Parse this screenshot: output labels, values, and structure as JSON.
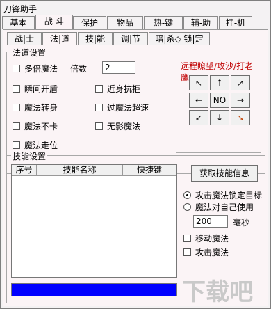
{
  "window": {
    "title": "刀锋助手"
  },
  "main_tabs": [
    "基本",
    "战-斗",
    "保护",
    "物品",
    "热-键",
    "辅-助",
    "挂-机"
  ],
  "sub_tabs": [
    "战|士",
    "法|道",
    "技|能",
    "调|节",
    "暗|杀◇ 锁|定"
  ],
  "fadao_group": {
    "title": "法道设置",
    "multi_magic": "多倍魔法",
    "multiplier_label": "倍数",
    "multiplier_value": "2",
    "instant_shield": "瞬间开盾",
    "close_resist": "近身抗拒",
    "magic_transfer": "魔法转身",
    "magic_overspeed": "过魔法超速",
    "magic_no_lag": "魔法不卡",
    "no_shadow": "无影魔法",
    "magic_walk": "魔法走位"
  },
  "direction_group": {
    "title": "远程瞭望/攻沙/打老鹰",
    "up_left": "↖",
    "up": "↑",
    "up_right": "↗",
    "left": "←",
    "center": "NO",
    "right": "→",
    "down_left": "↙",
    "down": "↓",
    "down_right": "↘"
  },
  "skill_group": {
    "title": "技能设置",
    "columns": [
      "序号",
      "技能名称",
      "快捷键"
    ],
    "get_skill_info": "获取技能信息",
    "attack_lock_target": "攻击魔法锁定目标",
    "magic_self": "魔法对自己使用",
    "ms_value": "200",
    "ms_unit": "毫秒",
    "move_magic": "移动魔法",
    "attack_magic": "攻击魔法"
  },
  "watermark": "下载吧"
}
